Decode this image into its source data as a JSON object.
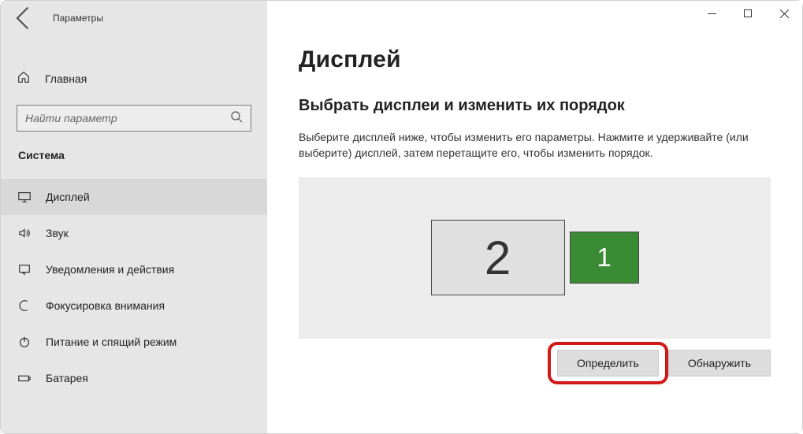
{
  "window": {
    "title": "Параметры"
  },
  "sidebar": {
    "home_label": "Главная",
    "search_placeholder": "Найти параметр",
    "category": "Система",
    "items": [
      {
        "label": "Дисплей"
      },
      {
        "label": "Звук"
      },
      {
        "label": "Уведомления и действия"
      },
      {
        "label": "Фокусировка внимания"
      },
      {
        "label": "Питание и спящий режим"
      },
      {
        "label": "Батарея"
      }
    ]
  },
  "main": {
    "page_title": "Дисплей",
    "section_title": "Выбрать дисплеи и изменить их порядок",
    "section_desc": "Выберите дисплей ниже, чтобы изменить его параметры. Нажмите и удерживайте (или выберите) дисплей, затем перетащите его, чтобы изменить порядок.",
    "monitor2_label": "2",
    "monitor1_label": "1",
    "identify_label": "Определить",
    "detect_label": "Обнаружить"
  }
}
